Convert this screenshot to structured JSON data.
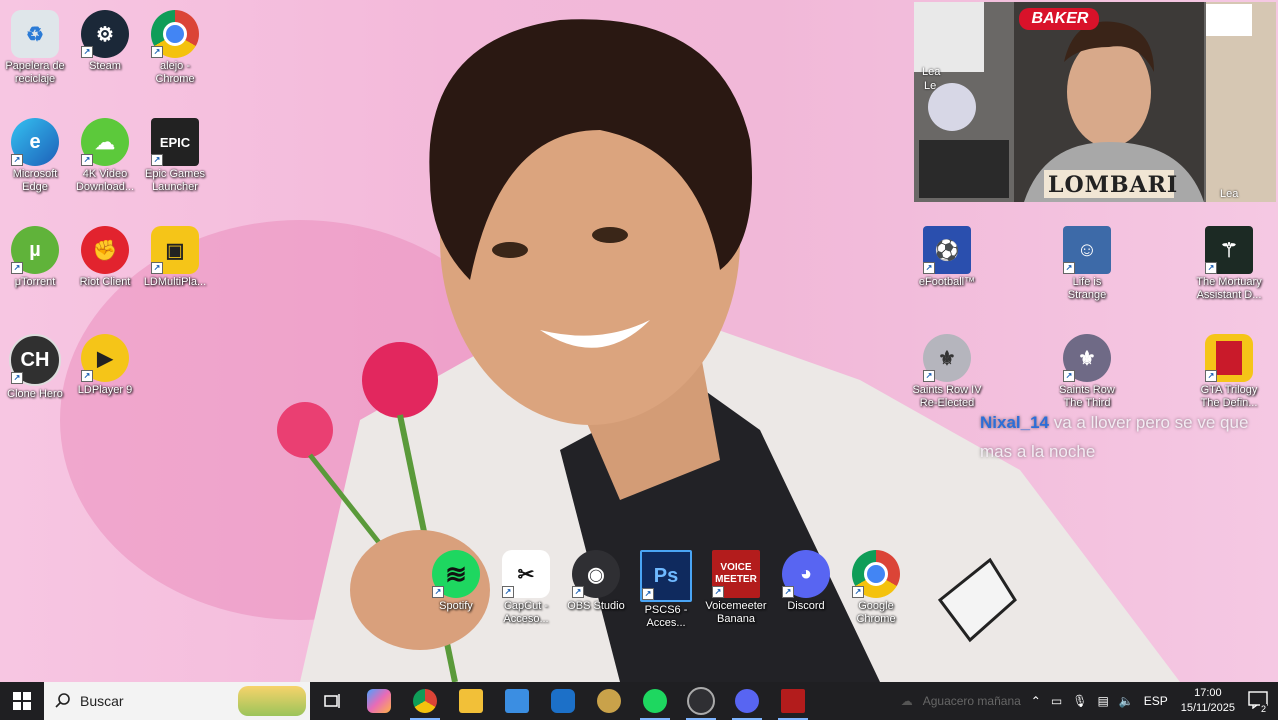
{
  "desktop_icons": [
    {
      "label": "Papelera de reciclaje",
      "icon": "recycle-bin-icon",
      "color": "#dfe6ea"
    },
    {
      "label": "Steam",
      "icon": "steam-icon",
      "color": "#1b2838"
    },
    {
      "label": "alejo - Chrome",
      "icon": "chrome-icon",
      "color": "#4285f4"
    },
    {
      "label": "Microsoft Edge",
      "icon": "edge-icon",
      "color": "#1d8fd8"
    },
    {
      "label": "4K Video Download...",
      "icon": "4k-video-icon",
      "color": "#5cc93b"
    },
    {
      "label": "Epic Games Launcher",
      "icon": "epic-games-icon",
      "color": "#222222"
    },
    {
      "label": "μTorrent",
      "icon": "utorrent-icon",
      "color": "#60b33a"
    },
    {
      "label": "Riot Client",
      "icon": "riot-icon",
      "color": "#e2232e"
    },
    {
      "label": "LDMultiPla...",
      "icon": "ldmultiplayer-icon",
      "color": "#f5c518"
    },
    {
      "label": "Clone Hero",
      "icon": "clone-hero-icon",
      "color": "#303030"
    },
    {
      "label": "LDPlayer 9",
      "icon": "ldplayer-icon",
      "color": "#f5c518"
    },
    {
      "label": "eFootball™",
      "icon": "efootball-icon",
      "color": "#2a4fae"
    },
    {
      "label": "Life is Strange",
      "icon": "life-is-strange-icon",
      "color": "#3d6aa8"
    },
    {
      "label": "The Mortuary Assistant D...",
      "icon": "mortuary-assistant-icon",
      "color": "#1c2a24"
    },
    {
      "label": "Saints Row IV Re-Elected",
      "icon": "saints-row-iv-icon",
      "color": "#b5b5bd"
    },
    {
      "label": "Saints Row The Third",
      "icon": "saints-row-third-icon",
      "color": "#6f6a86"
    },
    {
      "label": "GTA Trilogy The Defin...",
      "icon": "gta-trilogy-icon",
      "color": "#c91a2a"
    },
    {
      "label": "Spotify",
      "icon": "spotify-icon",
      "color": "#1ed760"
    },
    {
      "label": "CapCut - Acceso...",
      "icon": "capcut-icon",
      "color": "#ffffff"
    },
    {
      "label": "OBS Studio",
      "icon": "obs-icon",
      "color": "#2f2f33"
    },
    {
      "label": "PSCS6 - Acces...",
      "icon": "photoshop-icon",
      "color": "#0f2a5e"
    },
    {
      "label": "Voicemeeter Banana",
      "icon": "voicemeeter-icon",
      "color": "#b31c1c"
    },
    {
      "label": "Discord",
      "icon": "discord-icon",
      "color": "#5865f2"
    },
    {
      "label": "Google Chrome",
      "icon": "chrome-icon",
      "color": "#4285f4"
    }
  ],
  "webcam": {
    "sticker_top": "BAKER",
    "sticker_bottom": "LOMBARI",
    "partial_labels": [
      "Lea",
      "Le",
      "Lea"
    ]
  },
  "chat": {
    "user": "Nixal_14",
    "message": "va a llover pero se ve que mas a la noche"
  },
  "taskbar": {
    "search_placeholder": "Buscar",
    "apps": [
      {
        "name": "task-view",
        "color": "#ffffff"
      },
      {
        "name": "copilot",
        "color": "#e86bb7"
      },
      {
        "name": "chrome",
        "color": "#4285f4"
      },
      {
        "name": "file-explorer",
        "color": "#f2c038"
      },
      {
        "name": "microsoft-store",
        "color": "#3b8ee2"
      },
      {
        "name": "outlook",
        "color": "#1c70c8"
      },
      {
        "name": "league",
        "color": "#c9a24a"
      },
      {
        "name": "spotify",
        "color": "#1ed760"
      },
      {
        "name": "obs",
        "color": "#888888"
      },
      {
        "name": "discord",
        "color": "#5865f2"
      },
      {
        "name": "voicemeeter",
        "color": "#b31c1c"
      }
    ],
    "weather": "Aguacero mañana",
    "language": "ESP",
    "time": "17:00",
    "date": "15/11/2025",
    "notification_count": "2"
  }
}
